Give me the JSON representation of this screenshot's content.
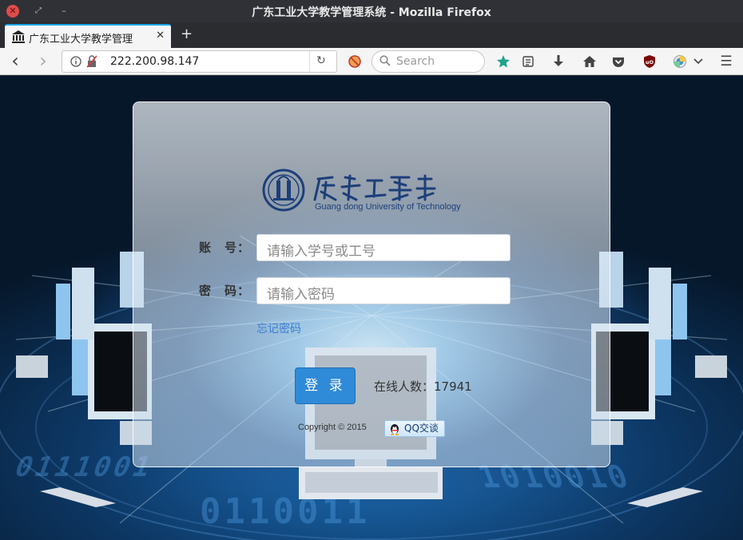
{
  "window": {
    "title": "广东工业大学教学管理系统 - Mozilla Firefox",
    "close_glyph": "✕",
    "max_glyph": "⤢",
    "min_glyph": "–"
  },
  "tab": {
    "title": "广东工业大学教学管理",
    "close_glyph": "✕",
    "new_tab_glyph": "+"
  },
  "navbar": {
    "url": "222.200.98.147",
    "search_placeholder": "Search",
    "back_glyph": "‹",
    "forward_glyph": "›",
    "reload_glyph": "↻",
    "menu_glyph": "☰",
    "icons": [
      "back-icon",
      "forward-icon",
      "info-icon",
      "reload-icon",
      "blocked-icon",
      "search-icon",
      "star-icon",
      "reader-icon",
      "download-icon",
      "home-icon",
      "pocket-icon",
      "ublock-icon",
      "extension-icon",
      "menu-icon"
    ]
  },
  "login": {
    "logo_subtitle": "Guang dong University of Technology",
    "account_label": "账　号：",
    "account_placeholder": "请输入学号或工号",
    "password_label": "密　码：",
    "password_placeholder": "请输入密码",
    "forgot_password": "忘记密码",
    "login_button": "登 录",
    "online_count_text": "在线人数：17941",
    "copyright": "Copyright © 2015",
    "qq_button": "QQ交谈"
  },
  "colors": {
    "tab_accent": "#1aa6e8",
    "login_button": "#2f8ad8",
    "link": "#3a7fd0",
    "star": "#1fa38a"
  }
}
